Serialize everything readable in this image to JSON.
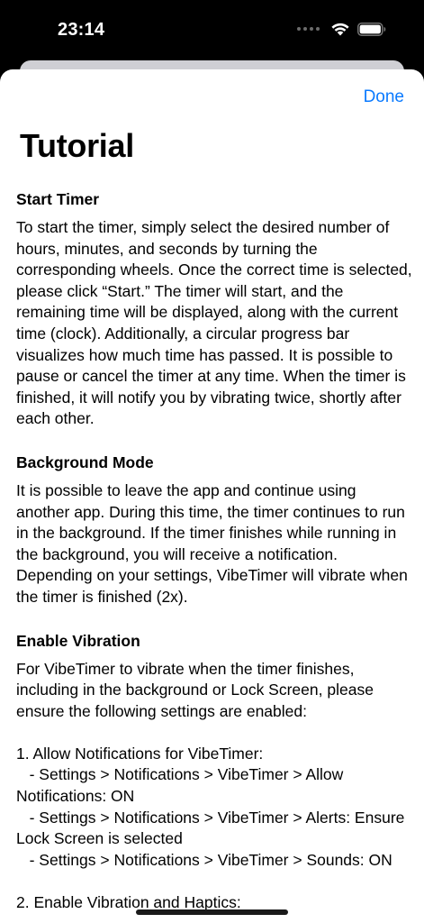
{
  "status_bar": {
    "time": "23:14"
  },
  "header": {
    "done_label": "Done",
    "title": "Tutorial"
  },
  "sections": [
    {
      "heading": "Start Timer",
      "body": "To start the timer, simply select the desired number of hours, minutes, and seconds by turning the corresponding wheels. Once the correct time is selected, please click “Start.” The timer will start, and the remaining time will be displayed, along with the current time (clock). Additionally, a circular progress bar visualizes how much time has passed. It is possible to pause or cancel the timer at any time. When the timer is finished, it will notify you by vibrating twice, shortly after each other."
    },
    {
      "heading": "Background Mode",
      "body": "It is possible to leave the app and continue using another app. During this time, the timer continues to run in the background. If the timer finishes while running in the background, you will receive a notification. Depending on your settings, VibeTimer will vibrate when the timer is finished (2x)."
    },
    {
      "heading": "Enable Vibration",
      "body": "For VibeTimer to vibrate when the timer finishes, including in the background or Lock Screen, please ensure the following settings are enabled:\n\n1. Allow Notifications for VibeTimer:\n   - Settings > Notifications > VibeTimer > Allow Notifications: ON\n   - Settings > Notifications > VibeTimer > Alerts: Ensure Lock Screen is selected\n   - Settings > Notifications > VibeTimer > Sounds: ON\n\n2. Enable Vibration and Haptics:"
    }
  ],
  "colors": {
    "accent": "#0a7aff",
    "sheet_background": "#ffffff",
    "screen_background": "#000000"
  }
}
